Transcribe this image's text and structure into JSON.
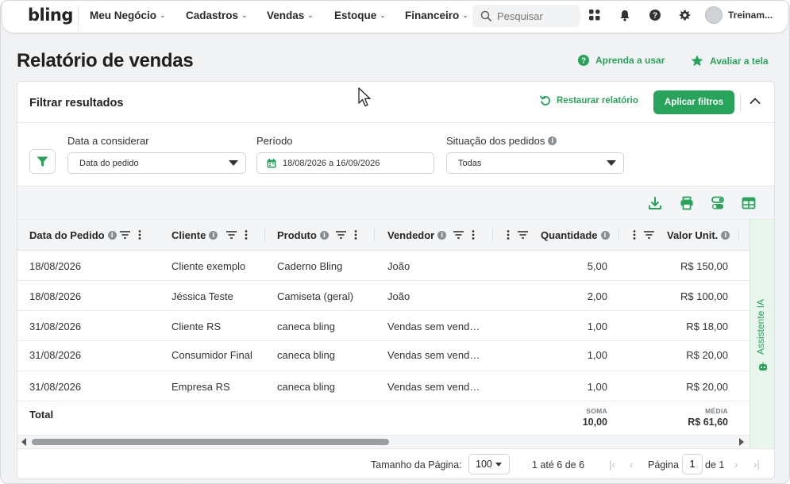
{
  "app": {
    "logo": "bling",
    "user": "Treinam..."
  },
  "nav": {
    "items": [
      {
        "label": "Meu Negócio"
      },
      {
        "label": "Cadastros"
      },
      {
        "label": "Vendas"
      },
      {
        "label": "Estoque"
      },
      {
        "label": "Financeiro"
      }
    ],
    "search_placeholder": "Pesquisar"
  },
  "page": {
    "title": "Relatório de vendas",
    "learn_link": "Aprenda a usar",
    "rate_link": "Avaliar a tela"
  },
  "filters": {
    "title": "Filtrar resultados",
    "restore_label": "Restaurar relatório",
    "apply_label": "Aplicar filtros",
    "date_field": {
      "label": "Data a considerar",
      "value": "Data do pedido"
    },
    "period_field": {
      "label": "Período",
      "value": "18/08/2026 a 16/09/2026"
    },
    "status_field": {
      "label": "Situação dos pedidos",
      "value": "Todas"
    }
  },
  "table": {
    "columns": [
      "Data do Pedido",
      "Cliente",
      "Produto",
      "Vendedor",
      "Quantidade",
      "Valor Unit."
    ],
    "rows": [
      [
        "18/08/2026",
        "Cliente exemplo",
        "Caderno Bling",
        "João",
        "5,00",
        "R$ 150,00"
      ],
      [
        "18/08/2026",
        "Jéssica Teste",
        "Camiseta (geral)",
        "João",
        "2,00",
        "R$ 100,00"
      ],
      [
        "31/08/2026",
        "Cliente RS",
        "caneca bling",
        "Vendas sem vend…",
        "1,00",
        "R$ 18,00"
      ],
      [
        "31/08/2026",
        "Consumidor Final",
        "caneca bling",
        "Vendas sem vend…",
        "1,00",
        "R$ 20,00"
      ],
      [
        "31/08/2026",
        "Empresa RS",
        "caneca bling",
        "Vendas sem vend…",
        "1,00",
        "R$ 20,00"
      ]
    ],
    "total_label": "Total",
    "sum_label": "SOMA",
    "sum_value": "10,00",
    "avg_label": "MÉDIA",
    "avg_value": "R$ 61,60"
  },
  "assistant": {
    "label": "Assistente IA"
  },
  "pagination": {
    "page_size_label": "Tamanho da Página:",
    "page_size": "100",
    "range": "1 até 6 de 6",
    "page_label": "Página",
    "page": "1",
    "of_label": "de 1"
  },
  "colors": {
    "accent": "#27a35a",
    "text": "#222222",
    "muted": "#8a8f96"
  }
}
